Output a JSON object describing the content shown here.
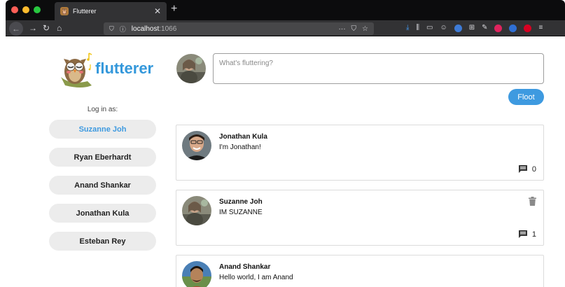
{
  "browser": {
    "tab_title": "Flutterer",
    "tab_close": "✕",
    "new_tab": "+",
    "url_host": "localhost",
    "url_port": ":1066",
    "url_actions": [
      "···",
      "⛉",
      "☆"
    ]
  },
  "app": {
    "logo_text": "flutterer",
    "login_label": "Log in as:",
    "users": [
      {
        "name": "Suzanne Joh",
        "active": true
      },
      {
        "name": "Ryan Eberhardt",
        "active": false
      },
      {
        "name": "Anand Shankar",
        "active": false
      },
      {
        "name": "Jonathan Kula",
        "active": false
      },
      {
        "name": "Esteban Rey",
        "active": false
      }
    ],
    "composer": {
      "placeholder": "What's fluttering?",
      "value": "",
      "submit_label": "Floot"
    },
    "posts": [
      {
        "author": "Jonathan Kula",
        "text": "I'm Jonathan!",
        "comments": "0",
        "deletable": false
      },
      {
        "author": "Suzanne Joh",
        "text": "IM SUZANNE",
        "comments": "1",
        "deletable": true
      },
      {
        "author": "Anand Shankar",
        "text": "Hello world, I am Anand",
        "comments": "",
        "deletable": false
      }
    ]
  },
  "colors": {
    "accent": "#3e9ae0",
    "logo": "#3498db",
    "chrome_dark": "#0c0c0d",
    "chrome_toolbar": "#323234"
  },
  "icons": [
    "back-icon",
    "forward-icon",
    "reload-icon",
    "home-icon",
    "shield-icon",
    "info-icon",
    "download-icon",
    "library-icon",
    "comment-icon",
    "trash-icon",
    "menu-icon"
  ]
}
